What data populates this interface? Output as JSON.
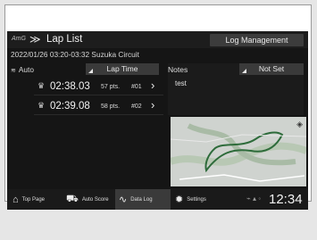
{
  "header": {
    "brand": "AmG",
    "chevron": "≫",
    "title": "Lap List",
    "log_management": "Log Management"
  },
  "session": {
    "datetime_track": "2022/01/26 03:20-03:32 Suzuka Circuit",
    "auto_label": "Auto"
  },
  "lap_list": {
    "sort_label": "Lap Time",
    "laps": [
      {
        "time": "02:38.03",
        "points": "57 pts.",
        "rank": "#01"
      },
      {
        "time": "02:39.08",
        "points": "58 pts.",
        "rank": "#02"
      }
    ]
  },
  "notes": {
    "header": "Notes",
    "status_btn": "Not Set",
    "text": "test"
  },
  "map": {
    "layers_icon": "layers-icon"
  },
  "nav": {
    "items": [
      {
        "label": "Top Page",
        "icon": "home-icon"
      },
      {
        "label": "Auto Score",
        "icon": "car-icon"
      },
      {
        "label": "Data Log",
        "icon": "data-log-icon"
      },
      {
        "label": "Settings",
        "icon": "gear-icon"
      }
    ]
  },
  "status_bar": {
    "clock": "12:34"
  }
}
